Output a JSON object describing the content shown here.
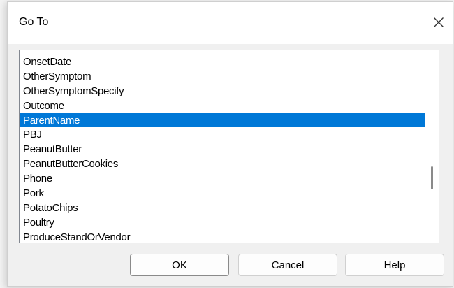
{
  "dialog": {
    "title": "Go To"
  },
  "list": {
    "items": [
      "OnsetDate",
      "OtherSymptom",
      "OtherSymptomSpecify",
      "Outcome",
      "ParentName",
      "PBJ",
      "PeanutButter",
      "PeanutButterCookies",
      "Phone",
      "Pork",
      "PotatoChips",
      "Poultry",
      "ProduceStandOrVendor"
    ],
    "selected_index": 4
  },
  "buttons": {
    "ok": "OK",
    "cancel": "Cancel",
    "help": "Help"
  },
  "colors": {
    "selection": "#0078d7",
    "selection_text": "#ffffff"
  },
  "icons": {
    "close": "close-icon"
  }
}
